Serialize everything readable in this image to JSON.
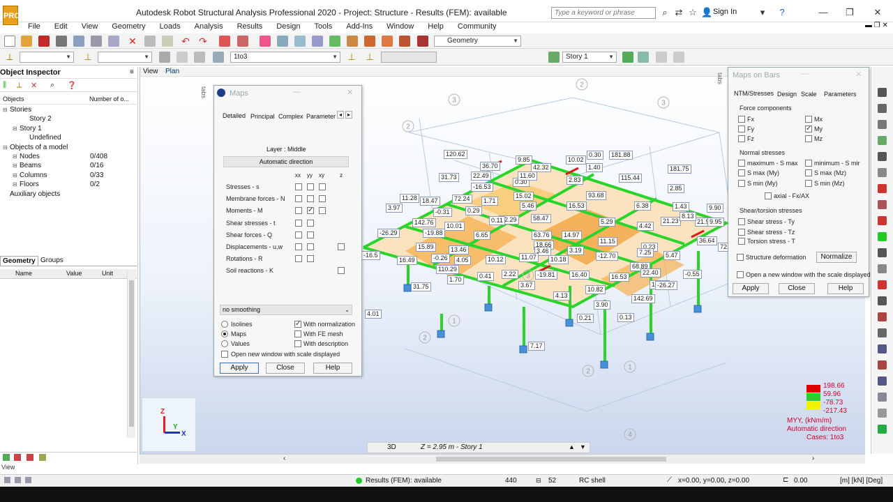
{
  "window": {
    "logo_text": "PRO",
    "title": "Autodesk Robot Structural Analysis Professional 2020 - Project: Structure - Results (FEM): available",
    "search_placeholder": "Type a keyword or phrase",
    "sign_in": "Sign In"
  },
  "menu": [
    "File",
    "Edit",
    "View",
    "Geometry",
    "Loads",
    "Analysis",
    "Results",
    "Design",
    "Tools",
    "Add-Ins",
    "Window",
    "Help",
    "Community"
  ],
  "toolbar": {
    "layout_combo": "Geometry",
    "cases_combo": "1to3",
    "story_combo": "Story 1"
  },
  "inspector": {
    "title": "Object Inspector",
    "col_objects": "Objects",
    "col_number": "Number of o...",
    "tree": [
      {
        "label": "Stories",
        "value": "",
        "indent": 0
      },
      {
        "label": "Story 2",
        "value": "",
        "indent": 2
      },
      {
        "label": "Story 1",
        "value": "",
        "indent": 1
      },
      {
        "label": "Undefined",
        "value": "",
        "indent": 2
      },
      {
        "label": "Objects of a model",
        "value": "",
        "indent": 0
      },
      {
        "label": "Nodes",
        "value": "0/408",
        "indent": 1
      },
      {
        "label": "Beams",
        "value": "0/16",
        "indent": 1
      },
      {
        "label": "Columns",
        "value": "0/33",
        "indent": 1
      },
      {
        "label": "Floors",
        "value": "0/2",
        "indent": 1
      },
      {
        "label": "Auxiliary objects",
        "value": "",
        "indent": 0
      }
    ],
    "tab_geometry": "Geometry",
    "tab_groups": "Groups",
    "prop_cols": [
      "Name",
      "Value",
      "Unit"
    ]
  },
  "view_tabs": {
    "view": "View",
    "plan": "Plan",
    "side": "tabs"
  },
  "maps_dialog": {
    "title": "Maps",
    "tabs": [
      "Detailed",
      "Principal",
      "Complex",
      "Parameter"
    ],
    "layer": "Layer : Middle",
    "auto_dir": "Automatic direction",
    "col_heads": [
      "xx",
      "yy",
      "xy",
      "z"
    ],
    "rows": [
      "Stresses - s",
      "Membrane forces - N",
      "Moments - M",
      "Shear stresses - t",
      "Shear forces - Q",
      "Displacements - u,w",
      "Rotations - R",
      "Soil reactions - K"
    ],
    "smoothing": "no smoothing",
    "opt_isolines": "Isolines",
    "opt_maps": "Maps",
    "opt_values": "Values",
    "with_normalization": "With normalization",
    "with_fe_mesh": "With FE mesh",
    "with_description": "With description",
    "open_new_window": "Open new window with scale displayed",
    "apply": "Apply",
    "close": "Close",
    "help": "Help"
  },
  "bars_dialog": {
    "title": "Maps on Bars",
    "tabs": [
      "NTM/Stresses",
      "Design",
      "Scale",
      "Parameters"
    ],
    "force_components": "Force components",
    "forces": [
      "Fx",
      "Fy",
      "Fz",
      "Mx",
      "My",
      "Mz"
    ],
    "normal_stresses": "Normal stresses",
    "normal": [
      "maximum - S max",
      "minimum - S mir",
      "S max (My)",
      "S max (Mz)",
      "S min (My)",
      "S min (Mz)"
    ],
    "axial": "axial - Fx/AX",
    "shear_torsion": "Shear/torsion stresses",
    "shear": [
      "Shear stress - Ty",
      "Shear stress - Tz",
      "Torsion stress - T"
    ],
    "structure_deformation": "Structure deformation",
    "normalize": "Normalize",
    "open_new_window": "Open a new window with the scale displayed",
    "apply": "Apply",
    "close": "Close",
    "help": "Help"
  },
  "legend": {
    "values": [
      "198.66",
      "59.96",
      "-78.73",
      "-217.43"
    ],
    "colors": [
      "#e00000",
      "#2ecc2e",
      "#f2f200"
    ],
    "quantity": "MYY, (kNm/m)",
    "direction": "Automatic direction",
    "cases": "Cases: 1to3"
  },
  "model_labels": [
    "120.62",
    "36.70",
    "9.85",
    "10.02",
    "0.30",
    "181.88",
    "31.73",
    "22.49",
    "42.32",
    "1.40",
    "115.44",
    "181.75",
    "0.30",
    "2.83",
    "-16.53",
    "11.60",
    "15.02",
    "11.28",
    "18.47",
    "72.24",
    "1.71",
    "93.68",
    "2.85",
    "3.97",
    "-0.31",
    "0.29",
    "5.46",
    "16.53",
    "6.38",
    "1.43",
    "9.90",
    "142.76",
    "10.01",
    "22.29",
    "58.47",
    "5.29",
    "4.42",
    "21.95",
    "21.23",
    "8.13",
    "9.95",
    "-26.29",
    "-19.88",
    "6.65",
    "63.76",
    "14.97",
    "11.15",
    "0.23",
    "36.64",
    "15.89",
    "13.46",
    "18.66",
    "3.46",
    "3.19",
    "7.25",
    "72.29",
    "-16.5",
    "16.49",
    "-0.26",
    "4.05",
    "10.12",
    "11.07",
    "10.18",
    "-12.70",
    "5.47",
    "18.61",
    "110.29",
    "1.70",
    "0.41",
    "2.22",
    "-19.81",
    "16.40",
    "16.53",
    "68.89",
    "22.40",
    "-0.55",
    "31.75",
    "3.67",
    "4.13",
    "10.82",
    "-26.27",
    "142.69",
    "4.01",
    "3.90",
    "0.21",
    "0.13",
    "7.17",
    "0.11"
  ],
  "axes_numbers": [
    "3",
    "2",
    "3",
    "2",
    "3",
    "2",
    "2",
    "1",
    "4",
    "1"
  ],
  "viewport_bottom": {
    "mode": "3D",
    "position": "Z = 2.95 m - Story 1"
  },
  "status": {
    "results": "Results (FEM): available",
    "count1": "440",
    "count2": "52",
    "section": "RC shell",
    "coords": "x=0.00, y=0.00, z=0.00",
    "angle": "0.00",
    "units": "[m] [kN] [Deg]",
    "view_label": "View"
  }
}
